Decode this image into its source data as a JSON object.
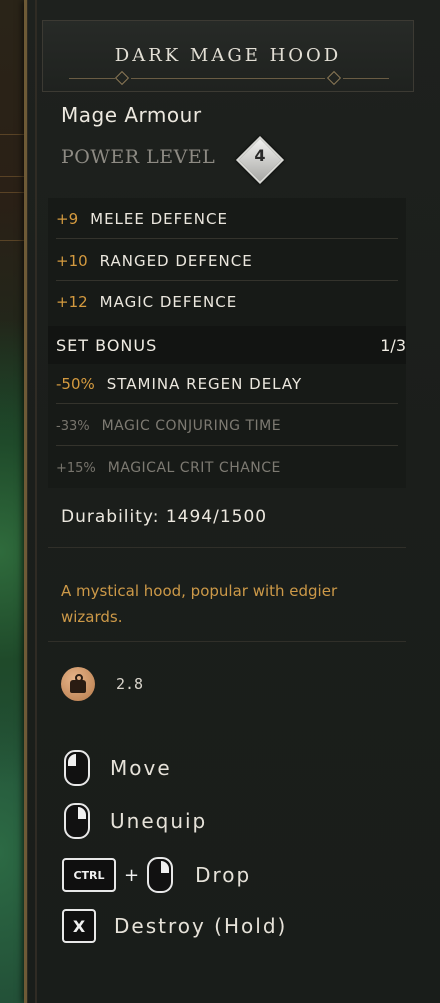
{
  "item": {
    "name": "DARK MAGE HOOD",
    "type": "Mage Armour",
    "power_level_label": "POWER LEVEL",
    "power_level": "4"
  },
  "stats": [
    {
      "value": "+9",
      "label": "MELEE DEFENCE"
    },
    {
      "value": "+10",
      "label": "RANGED DEFENCE"
    },
    {
      "value": "+12",
      "label": "MAGIC DEFENCE"
    }
  ],
  "set_bonus": {
    "label": "SET BONUS",
    "count": "1/3",
    "bonuses": [
      {
        "value": "-50%",
        "label": "STAMINA REGEN DELAY",
        "active": true
      },
      {
        "value": "-33%",
        "label": "MAGIC CONJURING TIME",
        "active": false
      },
      {
        "value": "+15%",
        "label": "MAGICAL CRIT CHANCE",
        "active": false
      }
    ]
  },
  "durability": "Durability: 1494/1500",
  "description": "A mystical hood, popular with edgier wizards.",
  "weight": {
    "icon": "weight-icon",
    "value": "2.8"
  },
  "actions": [
    {
      "input": "mouse-left",
      "label": "Move"
    },
    {
      "input": "mouse-right",
      "label": "Unequip"
    },
    {
      "modifier": "CTRL",
      "input": "mouse-right",
      "label": "Drop"
    },
    {
      "key": "X",
      "label": "Destroy (Hold)"
    }
  ],
  "colors": {
    "gold": "#d49a3f",
    "border": "#6e5a36",
    "text": "#ece8df",
    "dim": "#7d7a72"
  }
}
